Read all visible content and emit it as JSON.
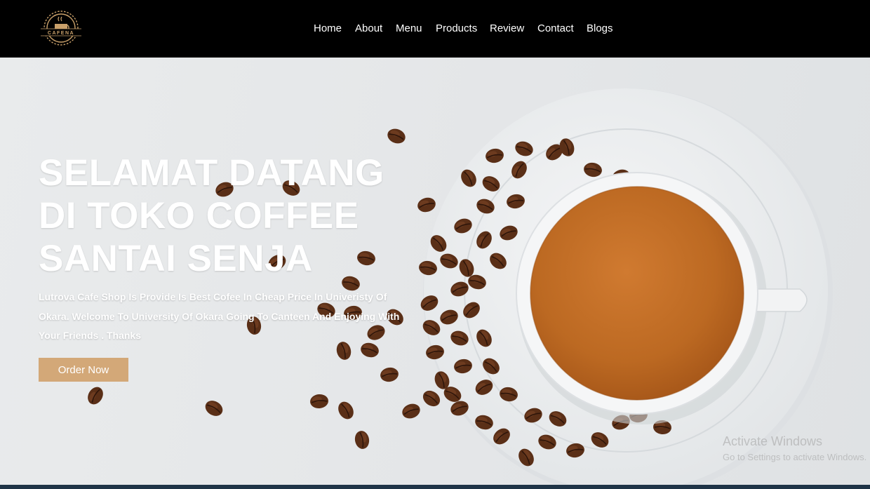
{
  "brand": {
    "logo_text": "CAFENA",
    "icon": "coffee-cup-logo-icon"
  },
  "nav": {
    "items": [
      {
        "label": "Home"
      },
      {
        "label": "About"
      },
      {
        "label": "Menu"
      },
      {
        "label": "Products"
      },
      {
        "label": "Review"
      },
      {
        "label": "Contact"
      },
      {
        "label": "Blogs"
      }
    ]
  },
  "hero": {
    "title_lines": [
      "SELAMAT DATANG",
      "DI TOKO COFFEE",
      "SANTAI SENJA"
    ],
    "description": "Lutrova Cafe Shop Is Provide Is Best Cofee In Cheap Price In Univeristy Of Okara. Welcome To University Of Okara Going To Canteen And Enjoying With Your Friends . Thanks",
    "cta_label": "Order Now",
    "image": "coffee-cup-with-beans-image"
  },
  "watermark": {
    "title": "Activate Windows",
    "subtitle": "Go to Settings to activate Windows."
  },
  "colors": {
    "navbar_bg": "#000000",
    "accent": "#d3a878",
    "hero_bg": "#e6e8ea",
    "coffee": "#c06d27",
    "bottom_bar": "#1f3447"
  }
}
